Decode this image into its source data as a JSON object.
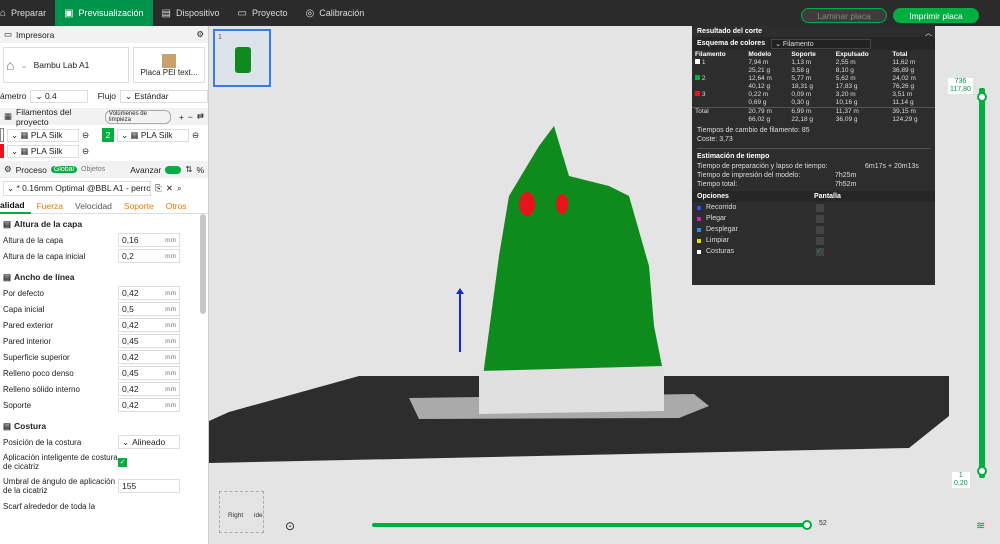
{
  "topbar": {
    "tabs": [
      {
        "label": "Preparar",
        "icon": "home-icon"
      },
      {
        "label": "Previsualización",
        "icon": "preview-icon"
      },
      {
        "label": "Dispositivo",
        "icon": "device-icon"
      },
      {
        "label": "Proyecto",
        "icon": "project-icon"
      },
      {
        "label": "Calibración",
        "icon": "calibration-icon"
      }
    ],
    "slice": "Laminar placa",
    "print": "Imprimir placa"
  },
  "printer": {
    "title": "Impresora",
    "name": "Bambu Lab A1",
    "plate": "Placa PEI text...",
    "nozzle_label": "ámetro",
    "nozzle": "0.4",
    "flow_label": "Flujo",
    "flow": "Estándar"
  },
  "filaments": {
    "title": "Filamentos del proyecto",
    "badge": "Volúmenes de limpieza",
    "items": [
      {
        "num": "",
        "name": "PLA Silk",
        "color": "#ffffff"
      },
      {
        "num": "2",
        "name": "PLA Silk",
        "color": "#00ae42"
      },
      {
        "num": "",
        "name": "PLA Silk",
        "color": "#e8141b"
      }
    ]
  },
  "process": {
    "title": "Proceso",
    "global": "Global",
    "objects": "Objetos",
    "advanced": "Avanzar",
    "profile": "* 0.16mm Optimal @BBL A1 - perros"
  },
  "subtabs": [
    "alidad",
    "Fuerza",
    "Velocidad",
    "Soporte",
    "Otros"
  ],
  "layer": {
    "title": "Altura de la capa",
    "rows": [
      {
        "label": "Altura de la capa",
        "value": "0,16",
        "unit": "mm"
      },
      {
        "label": "Altura de la capa inicial",
        "value": "0,2",
        "unit": "mm"
      }
    ]
  },
  "width": {
    "title": "Ancho de línea",
    "rows": [
      {
        "label": "Por defecto",
        "value": "0,42",
        "unit": "mm"
      },
      {
        "label": "Capa inicial",
        "value": "0,5",
        "unit": "mm"
      },
      {
        "label": "Pared exterior",
        "value": "0,42",
        "unit": "mm"
      },
      {
        "label": "Pared interior",
        "value": "0,45",
        "unit": "mm"
      },
      {
        "label": "Superficie superior",
        "value": "0,42",
        "unit": "mm"
      },
      {
        "label": "Relleno poco denso",
        "value": "0,45",
        "unit": "mm"
      },
      {
        "label": "Relleno sólido interno",
        "value": "0,42",
        "unit": "mm"
      },
      {
        "label": "Soporte",
        "value": "0,42",
        "unit": "mm"
      }
    ]
  },
  "seam": {
    "title": "Costura",
    "pos_label": "Posición de la costura",
    "pos": "Alineado",
    "smart": "Aplicación inteligente de costura de cicatriz",
    "angle_label": "Umbral de ángulo de aplicación de la cicatriz",
    "angle": "155",
    "scarf": "Scarf alrededor de toda la"
  },
  "result": {
    "title": "Resultado del corte",
    "scheme_label": "Esquema de colores",
    "scheme": "Filamento",
    "headers": [
      "Filamento",
      "Modelo",
      "Soporte",
      "Expulsado",
      "Total"
    ],
    "rows": [
      {
        "id": "1",
        "color": "#ffffff",
        "model": [
          "7,94 m",
          "25,21 g"
        ],
        "support": [
          "1,13 m",
          "3,58 g"
        ],
        "purge": [
          "2,55 m",
          "8,10 g"
        ],
        "total": [
          "11,62 m",
          "36,89 g"
        ]
      },
      {
        "id": "2",
        "color": "#00ae42",
        "model": [
          "12,64 m",
          "40,12 g"
        ],
        "support": [
          "5,77 m",
          "18,31 g"
        ],
        "purge": [
          "5,62 m",
          "17,83 g"
        ],
        "total": [
          "24,02 m",
          "76,26 g"
        ]
      },
      {
        "id": "3",
        "color": "#e8141b",
        "model": [
          "0,22 m",
          "0,69 g"
        ],
        "support": [
          "0,09 m",
          "0,30 g"
        ],
        "purge": [
          "3,20 m",
          "10,16 g"
        ],
        "total": [
          "3,51 m",
          "11,14 g"
        ]
      }
    ],
    "total": {
      "label": "Total",
      "model": [
        "20,79 m",
        "66,02 g"
      ],
      "support": [
        "6,99 m",
        "22,18 g"
      ],
      "purge": [
        "11,37 m",
        "36,09 g"
      ],
      "total": [
        "39,15 m",
        "124,29 g"
      ]
    },
    "changes_label": "Tiempos de cambio de filamento:",
    "changes": "85",
    "cost_label": "Coste:",
    "cost": "3,73",
    "time_title": "Estimación de tiempo",
    "times": [
      {
        "label": "Tiempo de preparación y lapso de tiempo:",
        "value": "6m17s + 20m13s"
      },
      {
        "label": "Tiempo de impresión del modelo:",
        "value": "7h25m"
      },
      {
        "label": "Tiempo total:",
        "value": "7h52m"
      }
    ],
    "opt_headers": [
      "Opciones",
      "Pantalla"
    ],
    "options": [
      {
        "label": "Recorrido",
        "color": "#3050ff",
        "checked": false
      },
      {
        "label": "Plegar",
        "color": "#c020c0",
        "checked": false
      },
      {
        "label": "Desplegar",
        "color": "#2090e0",
        "checked": false
      },
      {
        "label": "Limpiar",
        "color": "#e0e000",
        "checked": false
      },
      {
        "label": "Costuras",
        "color": "#ffffff",
        "checked": true
      }
    ]
  },
  "slider": {
    "top_layer": "736",
    "top_height": "117,80",
    "bottom_layer": "1",
    "bottom_height": "0,20",
    "move": "52"
  },
  "viewcube": {
    "right": "Right",
    "side": "ide"
  },
  "plate_num": "1"
}
